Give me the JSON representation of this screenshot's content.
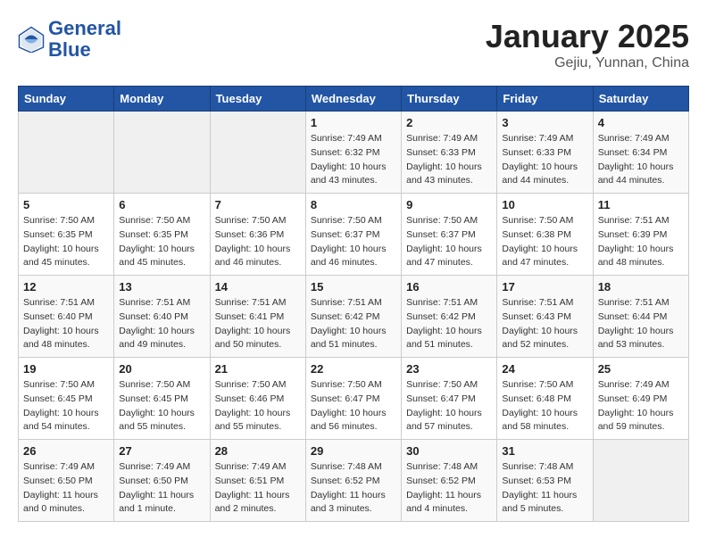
{
  "header": {
    "logo_line1": "General",
    "logo_line2": "Blue",
    "title": "January 2025",
    "subtitle": "Gejiu, Yunnan, China"
  },
  "weekdays": [
    "Sunday",
    "Monday",
    "Tuesday",
    "Wednesday",
    "Thursday",
    "Friday",
    "Saturday"
  ],
  "weeks": [
    [
      {
        "day": "",
        "info": ""
      },
      {
        "day": "",
        "info": ""
      },
      {
        "day": "",
        "info": ""
      },
      {
        "day": "1",
        "info": "Sunrise: 7:49 AM\nSunset: 6:32 PM\nDaylight: 10 hours\nand 43 minutes."
      },
      {
        "day": "2",
        "info": "Sunrise: 7:49 AM\nSunset: 6:33 PM\nDaylight: 10 hours\nand 43 minutes."
      },
      {
        "day": "3",
        "info": "Sunrise: 7:49 AM\nSunset: 6:33 PM\nDaylight: 10 hours\nand 44 minutes."
      },
      {
        "day": "4",
        "info": "Sunrise: 7:49 AM\nSunset: 6:34 PM\nDaylight: 10 hours\nand 44 minutes."
      }
    ],
    [
      {
        "day": "5",
        "info": "Sunrise: 7:50 AM\nSunset: 6:35 PM\nDaylight: 10 hours\nand 45 minutes."
      },
      {
        "day": "6",
        "info": "Sunrise: 7:50 AM\nSunset: 6:35 PM\nDaylight: 10 hours\nand 45 minutes."
      },
      {
        "day": "7",
        "info": "Sunrise: 7:50 AM\nSunset: 6:36 PM\nDaylight: 10 hours\nand 46 minutes."
      },
      {
        "day": "8",
        "info": "Sunrise: 7:50 AM\nSunset: 6:37 PM\nDaylight: 10 hours\nand 46 minutes."
      },
      {
        "day": "9",
        "info": "Sunrise: 7:50 AM\nSunset: 6:37 PM\nDaylight: 10 hours\nand 47 minutes."
      },
      {
        "day": "10",
        "info": "Sunrise: 7:50 AM\nSunset: 6:38 PM\nDaylight: 10 hours\nand 47 minutes."
      },
      {
        "day": "11",
        "info": "Sunrise: 7:51 AM\nSunset: 6:39 PM\nDaylight: 10 hours\nand 48 minutes."
      }
    ],
    [
      {
        "day": "12",
        "info": "Sunrise: 7:51 AM\nSunset: 6:40 PM\nDaylight: 10 hours\nand 48 minutes."
      },
      {
        "day": "13",
        "info": "Sunrise: 7:51 AM\nSunset: 6:40 PM\nDaylight: 10 hours\nand 49 minutes."
      },
      {
        "day": "14",
        "info": "Sunrise: 7:51 AM\nSunset: 6:41 PM\nDaylight: 10 hours\nand 50 minutes."
      },
      {
        "day": "15",
        "info": "Sunrise: 7:51 AM\nSunset: 6:42 PM\nDaylight: 10 hours\nand 51 minutes."
      },
      {
        "day": "16",
        "info": "Sunrise: 7:51 AM\nSunset: 6:42 PM\nDaylight: 10 hours\nand 51 minutes."
      },
      {
        "day": "17",
        "info": "Sunrise: 7:51 AM\nSunset: 6:43 PM\nDaylight: 10 hours\nand 52 minutes."
      },
      {
        "day": "18",
        "info": "Sunrise: 7:51 AM\nSunset: 6:44 PM\nDaylight: 10 hours\nand 53 minutes."
      }
    ],
    [
      {
        "day": "19",
        "info": "Sunrise: 7:50 AM\nSunset: 6:45 PM\nDaylight: 10 hours\nand 54 minutes."
      },
      {
        "day": "20",
        "info": "Sunrise: 7:50 AM\nSunset: 6:45 PM\nDaylight: 10 hours\nand 55 minutes."
      },
      {
        "day": "21",
        "info": "Sunrise: 7:50 AM\nSunset: 6:46 PM\nDaylight: 10 hours\nand 55 minutes."
      },
      {
        "day": "22",
        "info": "Sunrise: 7:50 AM\nSunset: 6:47 PM\nDaylight: 10 hours\nand 56 minutes."
      },
      {
        "day": "23",
        "info": "Sunrise: 7:50 AM\nSunset: 6:47 PM\nDaylight: 10 hours\nand 57 minutes."
      },
      {
        "day": "24",
        "info": "Sunrise: 7:50 AM\nSunset: 6:48 PM\nDaylight: 10 hours\nand 58 minutes."
      },
      {
        "day": "25",
        "info": "Sunrise: 7:49 AM\nSunset: 6:49 PM\nDaylight: 10 hours\nand 59 minutes."
      }
    ],
    [
      {
        "day": "26",
        "info": "Sunrise: 7:49 AM\nSunset: 6:50 PM\nDaylight: 11 hours\nand 0 minutes."
      },
      {
        "day": "27",
        "info": "Sunrise: 7:49 AM\nSunset: 6:50 PM\nDaylight: 11 hours\nand 1 minute."
      },
      {
        "day": "28",
        "info": "Sunrise: 7:49 AM\nSunset: 6:51 PM\nDaylight: 11 hours\nand 2 minutes."
      },
      {
        "day": "29",
        "info": "Sunrise: 7:48 AM\nSunset: 6:52 PM\nDaylight: 11 hours\nand 3 minutes."
      },
      {
        "day": "30",
        "info": "Sunrise: 7:48 AM\nSunset: 6:52 PM\nDaylight: 11 hours\nand 4 minutes."
      },
      {
        "day": "31",
        "info": "Sunrise: 7:48 AM\nSunset: 6:53 PM\nDaylight: 11 hours\nand 5 minutes."
      },
      {
        "day": "",
        "info": ""
      }
    ]
  ]
}
